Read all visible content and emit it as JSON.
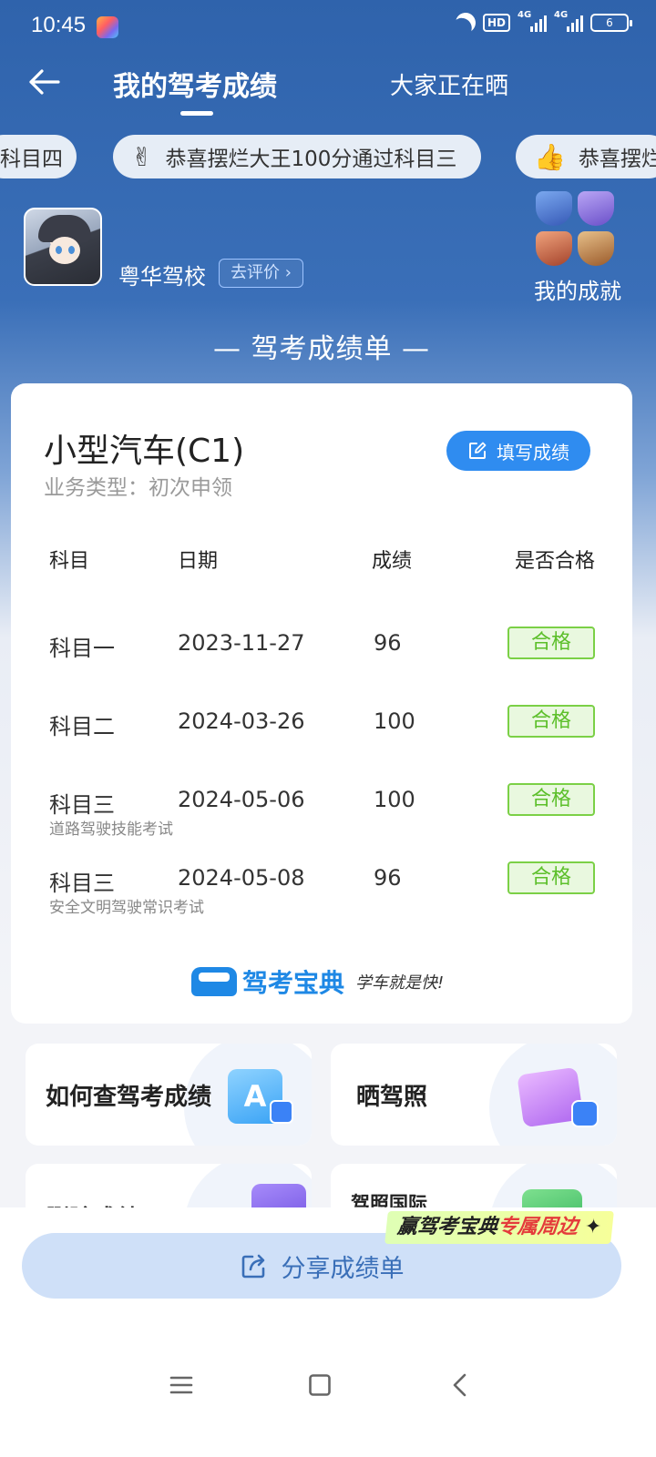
{
  "status_bar": {
    "time": "10:45",
    "hd_label": "HD",
    "sim1": "4G",
    "sim2": "4G",
    "battery": "6"
  },
  "nav": {
    "title": "我的驾考成绩",
    "secondary_tab": "大家正在晒"
  },
  "ticker": [
    {
      "text": "科目四"
    },
    {
      "emoji": "✌",
      "text": "恭喜摆烂大王100分通过科目三"
    },
    {
      "emoji": "👍",
      "text": "恭喜摆烂"
    }
  ],
  "school": {
    "name": "粤华驾校",
    "review_label": "去评价"
  },
  "achievements": {
    "label": "我的成就"
  },
  "report": {
    "heading": "— 驾考成绩单 —",
    "vehicle": "小型汽车(C1)",
    "business_type": "业务类型：初次申领",
    "fill_button": "填写成绩",
    "columns": [
      "科目",
      "日期",
      "成绩",
      "是否合格"
    ],
    "rows": [
      {
        "subject": "科目一",
        "date": "2023-11-27",
        "score": "96",
        "result": "合格",
        "note": ""
      },
      {
        "subject": "科目二",
        "date": "2024-03-26",
        "score": "100",
        "result": "合格",
        "note": ""
      },
      {
        "subject": "科目三",
        "date": "2024-05-06",
        "score": "100",
        "result": "合格",
        "note": "道路驾驶技能考试"
      },
      {
        "subject": "科目三",
        "date": "2024-05-08",
        "score": "96",
        "result": "合格",
        "note": "安全文明驾驶常识考试"
      }
    ],
    "brand_name": "驾考宝典",
    "brand_slogan": "学车就是快!"
  },
  "tiles": {
    "how_to_check": "如何查驾考成绩",
    "show_license": "晒驾照",
    "delete_scores": "删除成绩",
    "intl_license": "驾照国际"
  },
  "promo": {
    "prefix": "赢驾考宝典",
    "highlight": "专属周边"
  },
  "share": {
    "label": "分享成绩单"
  },
  "colors": {
    "header_blue": "#2f63ac",
    "accent_blue": "#2f8cf0",
    "pass_green": "#5cbf2a"
  }
}
